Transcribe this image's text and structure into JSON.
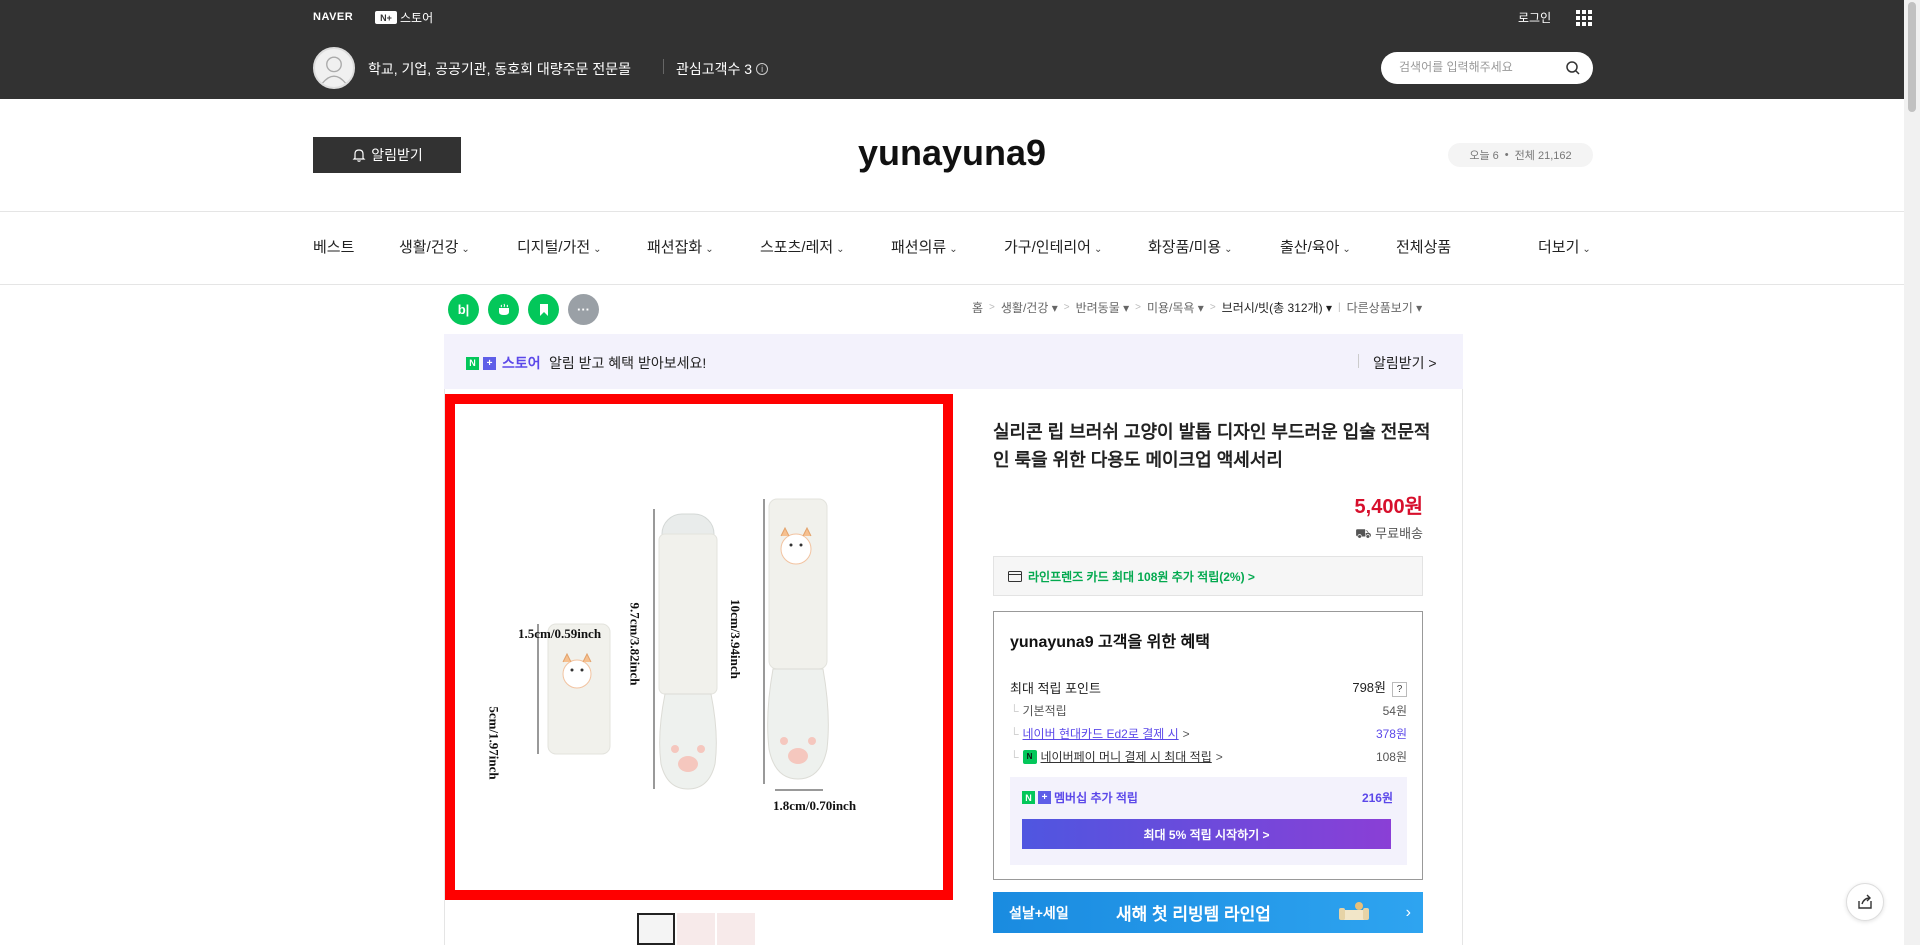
{
  "topbar": {
    "naver": "NAVER",
    "np_badge": "N+",
    "store": "스토어",
    "login": "로그인",
    "shop_desc": "학교, 기업, 공공기관, 동호회 대량주문 전문몰",
    "fans_label": "관심고객수 3",
    "info_icon": "ⓘ",
    "search_placeholder": "검색어를 입력해주세요"
  },
  "header": {
    "notify_label": "알림받기",
    "store_name": "yunayuna9",
    "visitor_today": "오늘 6",
    "visitor_dot": "•",
    "visitor_total": "전체 21,162"
  },
  "nav": {
    "items": [
      "베스트",
      "생활/건강",
      "디지털/가전",
      "패션잡화",
      "스포츠/레저",
      "패션의류",
      "가구/인테리어",
      "화장품/미용",
      "출산/육아",
      "전체상품",
      "더보기"
    ]
  },
  "social": {
    "icons": [
      "blog-icon",
      "talk-icon",
      "bookmark-icon",
      "more-icon"
    ]
  },
  "breadcrumb": {
    "home": "홈",
    "c1": "생활/건강",
    "c2": "반려동물",
    "c3": "미용/목욕",
    "c4": "브러시/빗(총 312개)",
    "other": "다른상품보기"
  },
  "promo": {
    "store": "스토어",
    "message": "알림 받고 혜택 받아보세요!",
    "alarm": "알림받기 >"
  },
  "image": {
    "label_top_left": "1.5cm/0.59inch",
    "label_left_side": "5cm/1.97inch",
    "label_mid": "9.7cm/3.82inch",
    "label_right": "10cm/3.94inch",
    "label_bottom": "1.8cm/0.70inch"
  },
  "product": {
    "title": "실리콘 립 브러쉬 고양이 발톱 디자인 부드러운 입술 전문적인 룩을 위한 다용도 메이크업 액세서리",
    "price": "5,400원",
    "shipping": "무료배송",
    "card_promo": "라인프렌즈 카드 최대 108원 추가 적립(2%) >"
  },
  "benefit": {
    "title": "yunayuna9 고객을 위한 혜택",
    "max_point_label": "최대 적립 포인트",
    "max_point_value": "798원",
    "qmark": "?",
    "basic_label": "기본적립",
    "basic_value": "54원",
    "card_label": "네이버 현대카드 Ed2로 결제 시",
    "card_chev": ">",
    "card_value": "378원",
    "pay_label": "네이버페이 머니 결제 시 최대 적립",
    "pay_chev": ">",
    "pay_value": "108원",
    "membership_label": "멤버십 추가 적립",
    "membership_value": "216원",
    "membership_btn": "최대 5% 적립 시작하기 >"
  },
  "banner": {
    "left": "설날+세일",
    "main": "새해 첫 리빙템 라인업",
    "chev": "›"
  },
  "colors": {
    "topbar": "#323232",
    "price": "#d70f2c",
    "accent_purple": "#5b48e9",
    "green": "#03c75a",
    "image_frame": "#ff0000",
    "banner": "#1a8be0"
  }
}
